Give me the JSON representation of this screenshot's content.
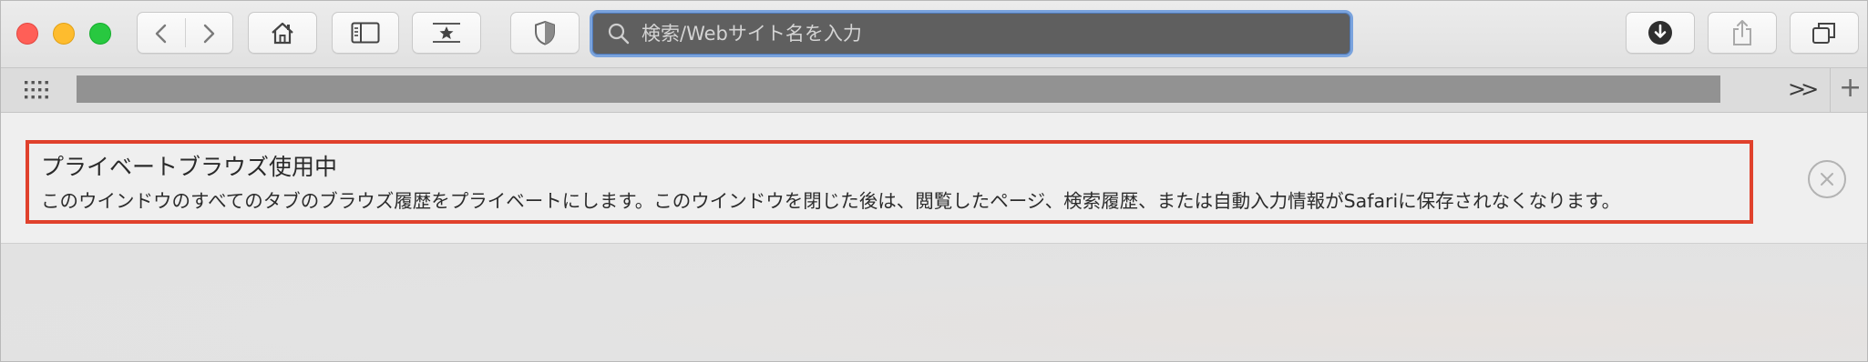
{
  "toolbar": {
    "window_controls": [
      "close",
      "minimize",
      "zoom"
    ],
    "buttons": {
      "back": "chevron-left-icon",
      "forward": "chevron-right-icon",
      "home": "home-icon",
      "sidebar": "sidebar-icon",
      "favorites": "star-icon",
      "privacy": "shield-icon",
      "downloads": "download-icon",
      "share": "share-icon",
      "tabs": "tab-overview-icon"
    },
    "address_placeholder": "検索/Webサイト名を入力"
  },
  "favorites_bar": {
    "more_label": ">>",
    "new_tab_label": "+"
  },
  "private_notice": {
    "title": "プライベートブラウズ使用中",
    "body": "このウインドウのすべてのタブのブラウズ履歴をプライベートにします。このウインドウを閉じた後は、閲覧したページ、検索履歴、または自動入力情報がSafariに保存されなくなります。",
    "highlight_color": "#e0412c"
  },
  "colors": {
    "address_focus_ring": "#7aa3dd",
    "address_background": "#5f5f5f"
  }
}
